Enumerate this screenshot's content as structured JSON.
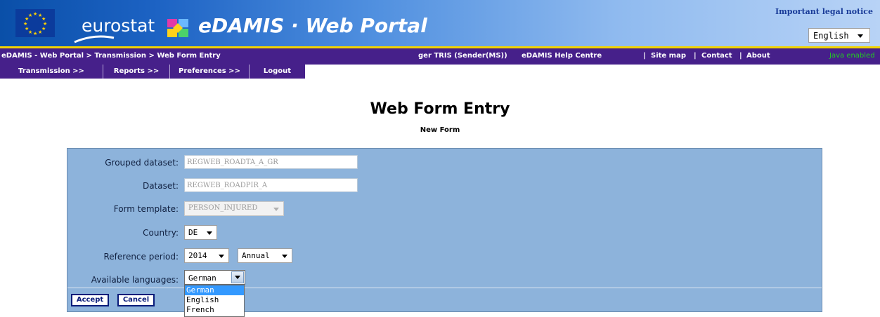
{
  "header": {
    "eurostat_text": "eurostat",
    "portal_title": "eDAMIS · Web Portal",
    "legal_notice": "Important legal notice",
    "language_selected": "English",
    "colors": {
      "banner_dark": "#0a4fa8",
      "banner_light": "#b8d3f6",
      "accent_yellow": "#f2d400",
      "nav_purple": "#46208a"
    }
  },
  "navbar": {
    "breadcrumb": "eDAMIS - Web Portal > Transmission > Web Form Entry",
    "user": "ger TRIS (Sender(MS))",
    "help_centre": "eDAMIS Help Centre",
    "separator": "|",
    "site_map": "Site map",
    "contact": "Contact",
    "about": "About",
    "java_status": "Java enabled"
  },
  "menu": {
    "items": [
      {
        "label": "Transmission >>"
      },
      {
        "label": "Reports >>"
      },
      {
        "label": "Preferences >>"
      },
      {
        "label": "Logout"
      }
    ]
  },
  "page": {
    "title": "Web Form Entry",
    "subtitle": "New Form"
  },
  "form": {
    "grouped_dataset": {
      "label": "Grouped dataset:",
      "value": "REGWEB_ROADTA_A_GR"
    },
    "dataset": {
      "label": "Dataset:",
      "value": "REGWEB_ROADPIR_A"
    },
    "form_template": {
      "label": "Form template:",
      "value": "PERSON_INJURED"
    },
    "country": {
      "label": "Country:",
      "value": "DE"
    },
    "reference_period": {
      "label": "Reference period:",
      "year": "2014",
      "frequency": "Annual"
    },
    "available_languages": {
      "label": "Available languages:",
      "value": "German",
      "options": [
        "German",
        "English",
        "French"
      ]
    },
    "accept_label": "Accept",
    "cancel_label": "Cancel"
  }
}
